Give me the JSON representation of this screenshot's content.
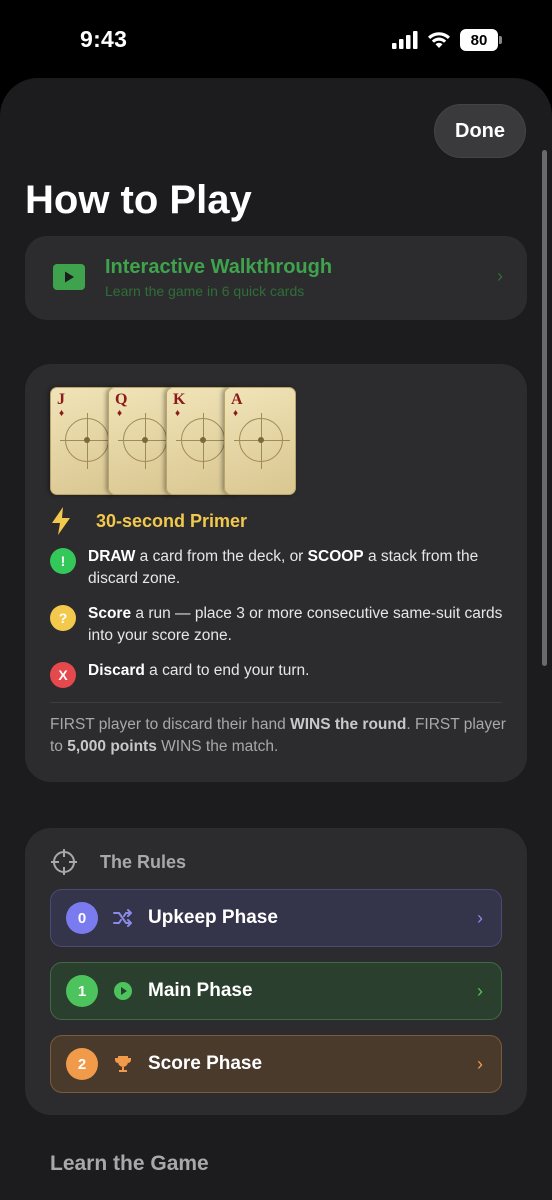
{
  "status": {
    "time": "9:43",
    "battery": "80"
  },
  "header": {
    "done_label": "Done",
    "title": "How to Play"
  },
  "walkthrough": {
    "title": "Interactive Walkthrough",
    "subtitle": "Learn the game in 6 quick cards",
    "icon": "play-icon"
  },
  "primer": {
    "cards": [
      {
        "rank": "J",
        "suit": "♦"
      },
      {
        "rank": "Q",
        "suit": "♦"
      },
      {
        "rank": "K",
        "suit": "♦"
      },
      {
        "rank": "A",
        "suit": "♦"
      }
    ],
    "title": "30-second Primer",
    "rules": [
      {
        "badge": "!",
        "color": "#34c759",
        "strong1": "DRAW",
        "text1": " a card from the deck, or ",
        "strong2": "SCOOP",
        "text2": " a stack from the discard zone."
      },
      {
        "badge": "?",
        "color": "#f2c94c",
        "strong1": "Score",
        "text1": " a run — place 3 or more consecutive same-suit cards into your score zone.",
        "strong2": "",
        "text2": ""
      },
      {
        "badge": "X",
        "color": "#e5484d",
        "strong1": "Discard",
        "text1": " a card to end your turn.",
        "strong2": "",
        "text2": ""
      }
    ],
    "footer": {
      "t1": "FIRST player to discard their hand ",
      "b1": "WINS the round",
      "t2": ".   FIRST player to ",
      "b2": "5,000 points",
      "t3": " WINS the match."
    }
  },
  "rules_section": {
    "title": "The Rules",
    "phases": [
      {
        "num": "0",
        "label": "Upkeep Phase",
        "icon": "shuffle-icon",
        "bg": "#34344a",
        "border": "#4a4a78",
        "num_color": "#7b7bf0",
        "chev": "#8a8ae8"
      },
      {
        "num": "1",
        "label": "Main Phase",
        "icon": "play-circle-icon",
        "bg": "#2b3f2e",
        "border": "#3c6b44",
        "num_color": "#4cc35d",
        "chev": "#4cc35d"
      },
      {
        "num": "2",
        "label": "Score Phase",
        "icon": "trophy-icon",
        "bg": "#4a3a2c",
        "border": "#7a5a3a",
        "num_color": "#f09a4a",
        "chev": "#f09a4a"
      }
    ]
  },
  "learn": {
    "title": "Learn the Game"
  }
}
